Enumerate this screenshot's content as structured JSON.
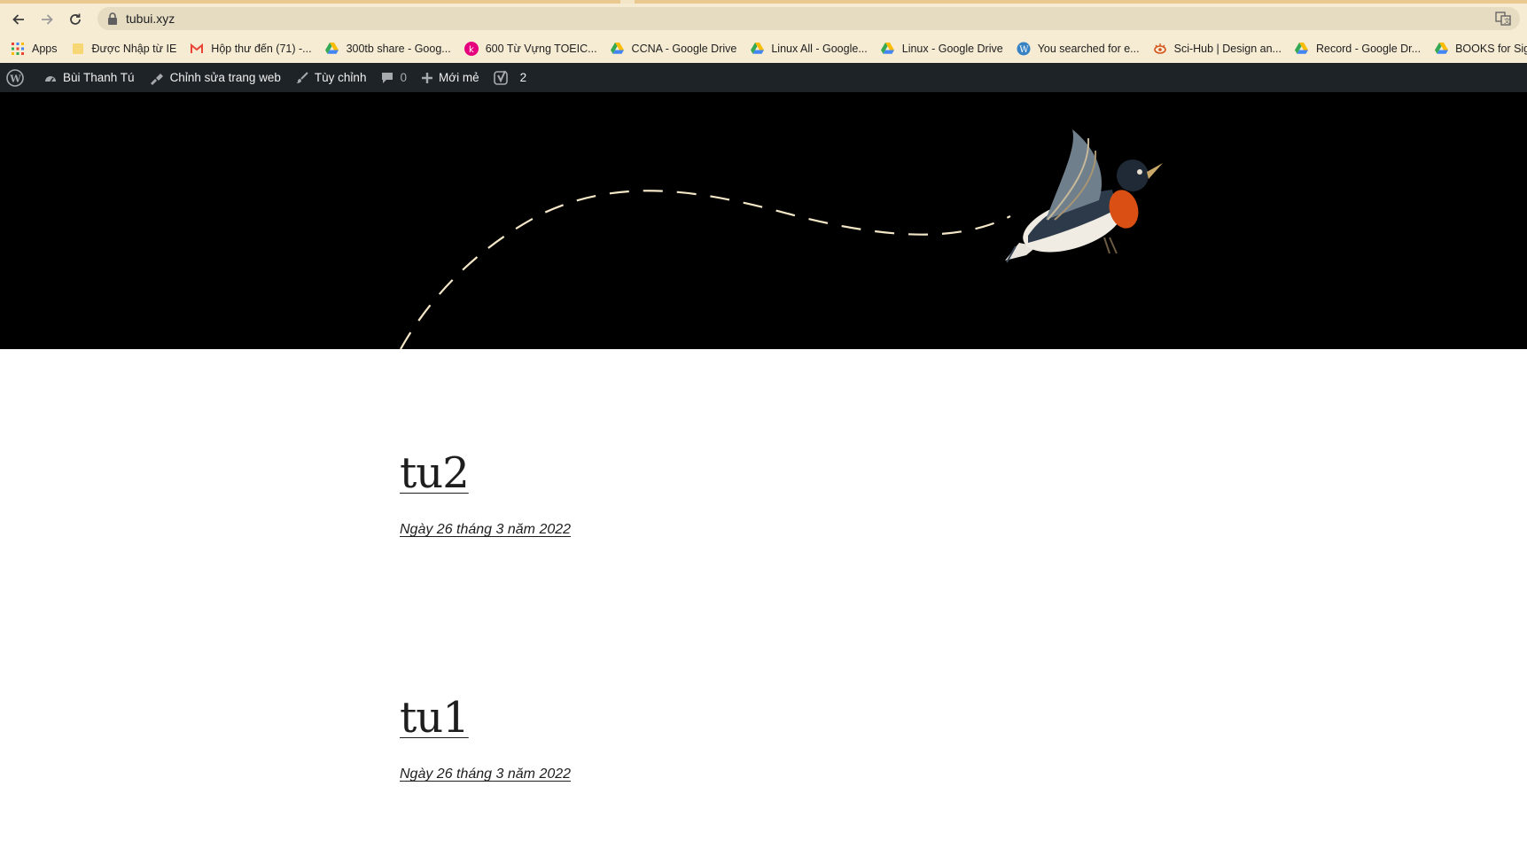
{
  "browser": {
    "url": "tubui.xyz",
    "bookmarks": [
      {
        "label": "Apps",
        "icon": "apps-grid-icon"
      },
      {
        "label": "Được Nhập từ IE",
        "icon": "folder-icon"
      },
      {
        "label": "Hộp thư đến (71) -...",
        "icon": "gmail-icon"
      },
      {
        "label": "300tb share - Goog...",
        "icon": "google-drive-icon"
      },
      {
        "label": "600 Từ Vựng TOEIC...",
        "icon": "k-site-icon"
      },
      {
        "label": "CCNA - Google Drive",
        "icon": "google-drive-icon"
      },
      {
        "label": "Linux All - Google...",
        "icon": "google-drive-icon"
      },
      {
        "label": "Linux - Google Drive",
        "icon": "google-drive-icon"
      },
      {
        "label": "You searched for e...",
        "icon": "wordpress-icon"
      },
      {
        "label": "Sci-Hub | Design an...",
        "icon": "scihub-icon"
      },
      {
        "label": "Record - Google Dr...",
        "icon": "google-drive-icon"
      },
      {
        "label": "BOOKS for Signallin...",
        "icon": "google-drive-icon"
      }
    ]
  },
  "adminbar": {
    "site_name": "Bùi Thanh Tú",
    "edit_site": "Chỉnh sửa trang web",
    "customize": "Tùy chỉnh",
    "comments_count": "0",
    "new": "Mới mẻ",
    "yoast_count": "2"
  },
  "posts": [
    {
      "title": "tu2",
      "date": "Ngày 26 tháng 3 năm 2022"
    },
    {
      "title": "tu1",
      "date": "Ngày 26 tháng 3 năm 2022"
    }
  ],
  "colors": {
    "browser_toolbar": "#f6ebd3",
    "admin_bar": "#1d2327",
    "header_bg": "#000000",
    "text": "#1e1e1e"
  }
}
